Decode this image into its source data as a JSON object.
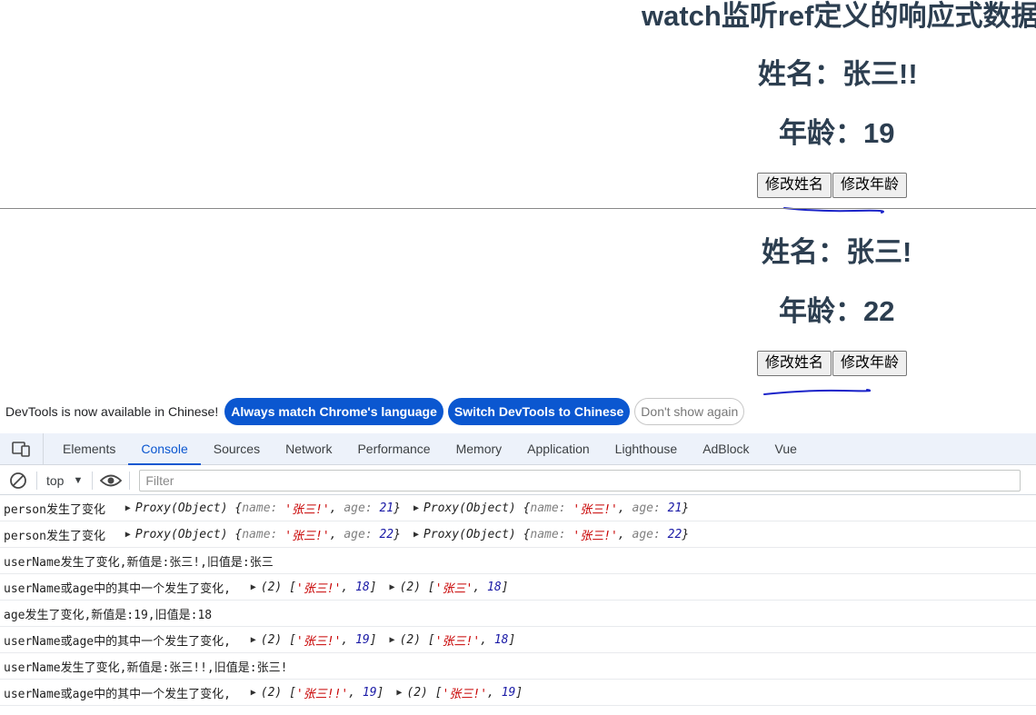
{
  "app": {
    "title": "watch监听ref定义的响应式数据",
    "sections": [
      {
        "name_label": "姓名：张三!!",
        "age_label": "年龄：19",
        "btn_name": "修改姓名",
        "btn_age": "修改年龄"
      },
      {
        "name_label": "姓名：张三!",
        "age_label": "年龄：22",
        "btn_name": "修改姓名",
        "btn_age": "修改年龄"
      }
    ]
  },
  "infobar": {
    "message": "DevTools is now available in Chinese!",
    "always_match": "Always match Chrome's language",
    "switch_chinese": "Switch DevTools to Chinese",
    "dont_show": "Don't show again"
  },
  "devtools": {
    "tabs": [
      "Elements",
      "Console",
      "Sources",
      "Network",
      "Performance",
      "Memory",
      "Application",
      "Lighthouse",
      "AdBlock",
      "Vue"
    ],
    "active_tab": "Console",
    "context": "top",
    "filter_placeholder": "Filter",
    "colors": {
      "accent": "#0b57d0",
      "string": "#c80000",
      "number": "#1a1aa6",
      "key": "#7f7f7f"
    }
  },
  "console": {
    "logs": [
      {
        "prefix": "person发生了变化 ",
        "objects": [
          {
            "label": "Proxy(Object) ",
            "open": "{",
            "entries": [
              [
                "name",
                "'张三!'"
              ],
              [
                "age",
                "21"
              ]
            ],
            "close": "}"
          },
          {
            "label": "Proxy(Object) ",
            "open": "{",
            "entries": [
              [
                "name",
                "'张三!'"
              ],
              [
                "age",
                "21"
              ]
            ],
            "close": "}"
          }
        ]
      },
      {
        "prefix": "person发生了变化 ",
        "objects": [
          {
            "label": "Proxy(Object) ",
            "open": "{",
            "entries": [
              [
                "name",
                "'张三!'"
              ],
              [
                "age",
                "22"
              ]
            ],
            "close": "}"
          },
          {
            "label": "Proxy(Object) ",
            "open": "{",
            "entries": [
              [
                "name",
                "'张三!'"
              ],
              [
                "age",
                "22"
              ]
            ],
            "close": "}"
          }
        ]
      },
      {
        "prefix": "userName发生了变化,新值是:张三!,旧值是:张三",
        "objects": []
      },
      {
        "prefix": "userName或age中的其中一个发生了变化, ",
        "objects": [
          {
            "label": "(2) ",
            "open": "[",
            "entries": [
              [
                "",
                "'张三!'"
              ],
              [
                "",
                "18"
              ]
            ],
            "close": "]"
          },
          {
            "label": "(2) ",
            "open": "[",
            "entries": [
              [
                "",
                "'张三'"
              ],
              [
                "",
                "18"
              ]
            ],
            "close": "]"
          }
        ]
      },
      {
        "prefix": "age发生了变化,新值是:19,旧值是:18",
        "objects": []
      },
      {
        "prefix": "userName或age中的其中一个发生了变化, ",
        "objects": [
          {
            "label": "(2) ",
            "open": "[",
            "entries": [
              [
                "",
                "'张三!'"
              ],
              [
                "",
                "19"
              ]
            ],
            "close": "]"
          },
          {
            "label": "(2) ",
            "open": "[",
            "entries": [
              [
                "",
                "'张三!'"
              ],
              [
                "",
                "18"
              ]
            ],
            "close": "]"
          }
        ]
      },
      {
        "prefix": "userName发生了变化,新值是:张三!!,旧值是:张三!",
        "objects": []
      },
      {
        "prefix": "userName或age中的其中一个发生了变化, ",
        "objects": [
          {
            "label": "(2) ",
            "open": "[",
            "entries": [
              [
                "",
                "'张三!!'"
              ],
              [
                "",
                "19"
              ]
            ],
            "close": "]"
          },
          {
            "label": "(2) ",
            "open": "[",
            "entries": [
              [
                "",
                "'张三!'"
              ],
              [
                "",
                "19"
              ]
            ],
            "close": "]"
          }
        ]
      }
    ]
  }
}
